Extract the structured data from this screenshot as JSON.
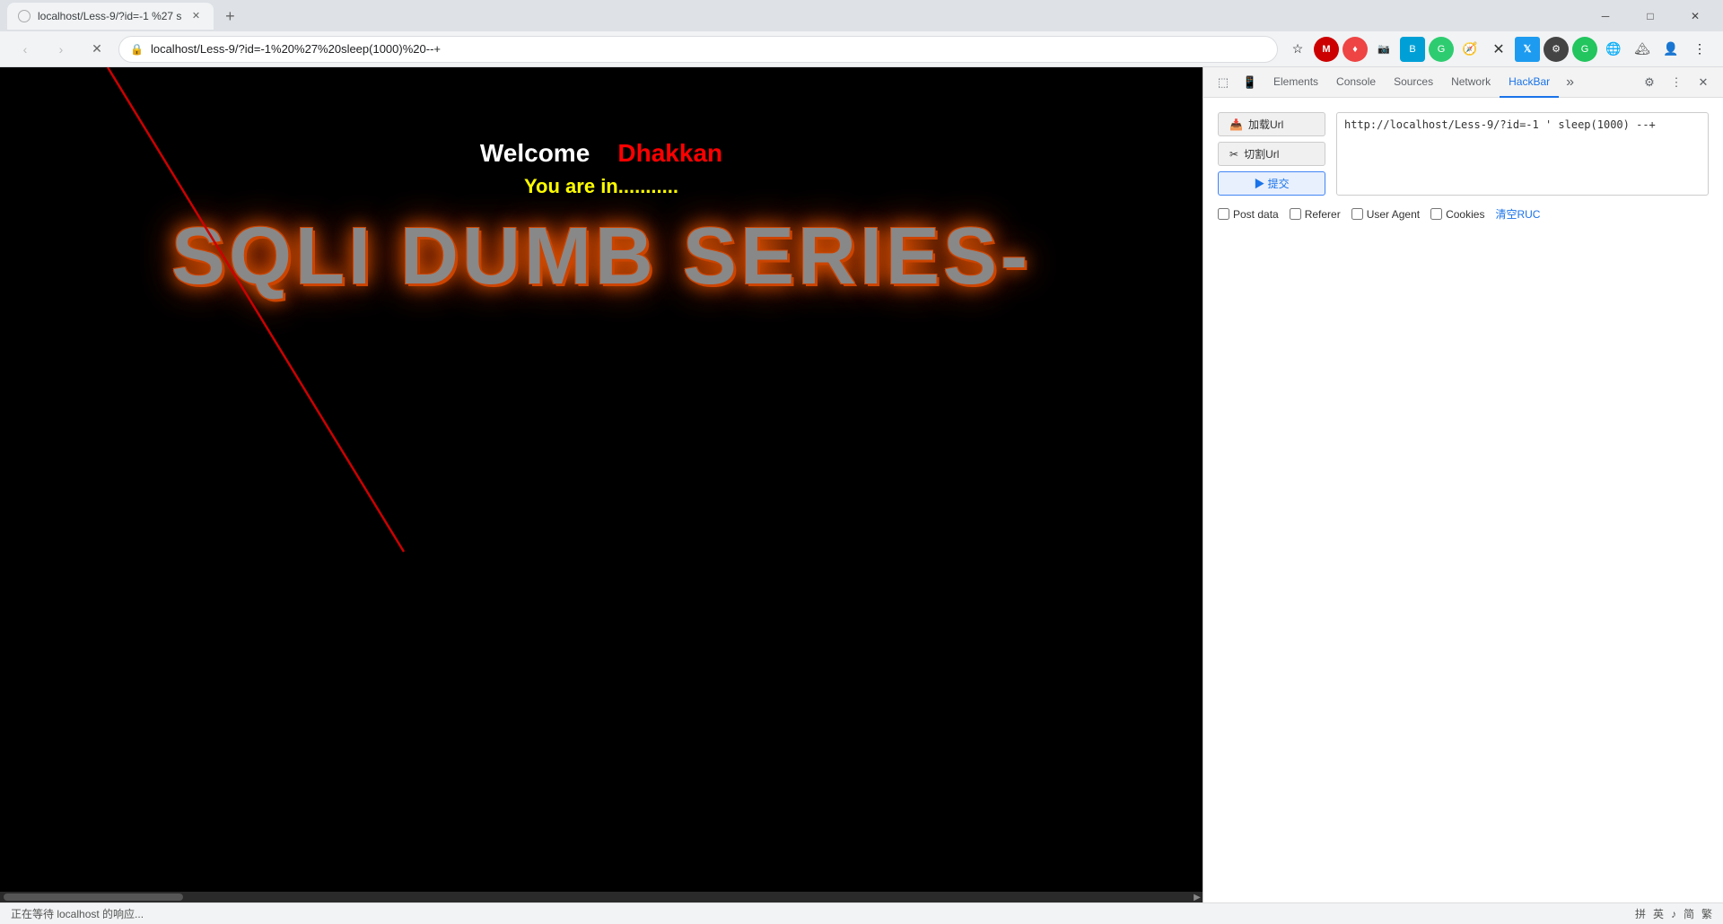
{
  "browser": {
    "tab_title": "localhost/Less-9/?id=-1 %27 s",
    "new_tab_label": "+",
    "url": "localhost/Less-9/?id=-1%20%27%20sleep(1000)%20--+",
    "url_display_host": "localhost",
    "url_display_path": "/Less-9/?id=-1%20%27%20sleep(1000)%20--+"
  },
  "nav": {
    "back_label": "‹",
    "forward_label": "›",
    "reload_label": "✕",
    "home_label": "⌂",
    "star_label": "☆",
    "menu_label": "⋮"
  },
  "window_controls": {
    "minimize": "─",
    "maximize": "□",
    "close": "✕"
  },
  "webpage": {
    "welcome_label": "Welcome",
    "user_label": "Dhakkan",
    "you_are_in": "You are in...........",
    "sqli_title": "SQLI DUMB SERIES-"
  },
  "devtools": {
    "tabs": [
      {
        "label": "Elements",
        "active": false
      },
      {
        "label": "Console",
        "active": false
      },
      {
        "label": "Sources",
        "active": false
      },
      {
        "label": "Network",
        "active": false
      },
      {
        "label": "HackBar",
        "active": true
      }
    ],
    "more_label": "»"
  },
  "hackbar": {
    "load_url_label": "加载Url",
    "split_url_label": "切割Url",
    "submit_label": "▶ 提交",
    "url_value": "http://localhost/Less-9/?id=-1 ' sleep(1000) --+",
    "checkboxes": [
      {
        "label": "Post data",
        "checked": false
      },
      {
        "label": "Referer",
        "checked": false
      },
      {
        "label": "User Agent",
        "checked": false
      },
      {
        "label": "Cookies",
        "checked": false
      }
    ],
    "clear_label": "清空RUC"
  },
  "status_bar": {
    "loading_text": "正在等待 localhost 的响应...",
    "right_items": [
      "拼",
      "英",
      "♪",
      "简",
      "繁"
    ]
  }
}
